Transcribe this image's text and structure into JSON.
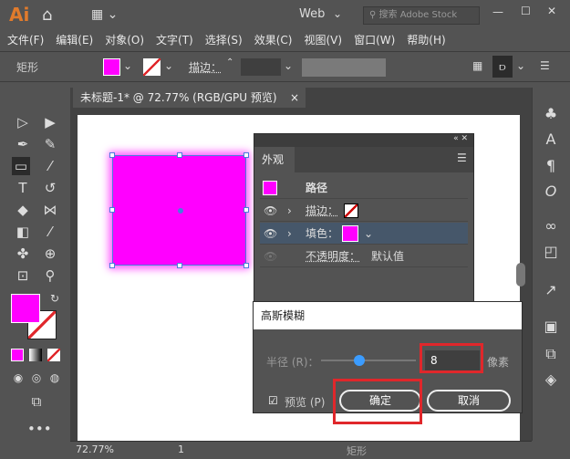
{
  "titlebar": {
    "logo": "Ai",
    "workspace": "Web",
    "search_placeholder": "搜索 Adobe Stock"
  },
  "menu": [
    "文件(F)",
    "编辑(E)",
    "对象(O)",
    "文字(T)",
    "选择(S)",
    "效果(C)",
    "视图(V)",
    "窗口(W)",
    "帮助(H)"
  ],
  "control": {
    "object_type": "矩形",
    "stroke_label": "描边：",
    "fill_color": "#ff00ff"
  },
  "document_tab": {
    "title": "未标题-1* @ 72.77% (RGB/GPU 预览)"
  },
  "appearance_panel": {
    "title": "外观",
    "path_label": "路径",
    "stroke_label": "描边：",
    "fill_label": "填色：",
    "opacity_label": "不透明度：",
    "opacity_value": "默认值"
  },
  "gaussian_blur": {
    "title": "高斯模糊",
    "radius_label": "半径 (R)：",
    "radius_value": "8",
    "unit": "像素",
    "preview_label": "预览 (P)",
    "preview_checked": true,
    "ok": "确定",
    "cancel": "取消",
    "slider_fraction": 0.4
  },
  "status": {
    "zoom": "72.77%",
    "page": "1",
    "tool": "矩形"
  },
  "colors": {
    "accent": "#ff00ff",
    "highlight": "#e0272b"
  }
}
